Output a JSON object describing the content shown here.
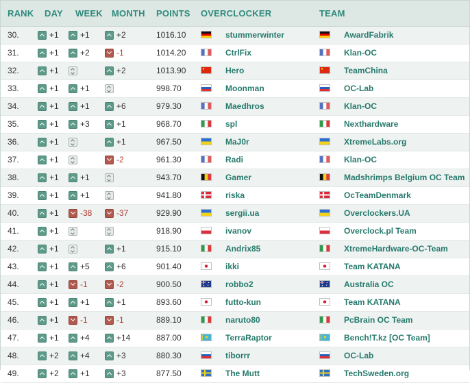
{
  "header": {
    "rank": "RANK",
    "day": "DAY",
    "week": "WEEK",
    "month": "MONTH",
    "points": "POINTS",
    "overclocker": "OVERCLOCKER",
    "team": "TEAM"
  },
  "colors": {
    "header_bg": "#dde8e5",
    "header_text": "#2f8a7c",
    "link": "#277a6d",
    "up": "#5e9a89",
    "down": "#b05a50",
    "negative_text": "#b03d30"
  },
  "flags": {
    "de": {
      "type": "h",
      "colors": [
        "#111111",
        "#dd0000",
        "#ffce00"
      ]
    },
    "fr": {
      "type": "v",
      "colors": [
        "#5472c2",
        "#ffffff",
        "#e05a5a"
      ]
    },
    "cn": {
      "type": "solid",
      "colors": [
        "#de2910"
      ]
    },
    "si": {
      "type": "h",
      "colors": [
        "#ffffff",
        "#2b5fbf",
        "#e03030"
      ]
    },
    "it": {
      "type": "v",
      "colors": [
        "#2f9a4a",
        "#ffffff",
        "#d83a3a"
      ]
    },
    "ua": {
      "type": "h",
      "colors": [
        "#2a6fd6",
        "#f3d31a"
      ]
    },
    "be": {
      "type": "v",
      "colors": [
        "#111111",
        "#f5d21c",
        "#e03a3a"
      ]
    },
    "dk": {
      "type": "cross",
      "colors": [
        "#d6293a",
        "#ffffff"
      ]
    },
    "pl": {
      "type": "h",
      "colors": [
        "#ffffff",
        "#dc2f3c"
      ]
    },
    "jp": {
      "type": "disc",
      "colors": [
        "#ffffff",
        "#d02035"
      ]
    },
    "au": {
      "type": "au",
      "colors": [
        "#1f3a8a",
        "#ffffff",
        "#cc2233"
      ]
    },
    "kz": {
      "type": "kz",
      "colors": [
        "#46b5d6",
        "#f3d31a"
      ]
    },
    "se": {
      "type": "cross",
      "colors": [
        "#2f6fbf",
        "#f3d31a"
      ]
    }
  },
  "rows": [
    {
      "rank": "30.",
      "day": {
        "dir": "up",
        "v": "+1"
      },
      "week": {
        "dir": "up",
        "v": "+1"
      },
      "month": {
        "dir": "up",
        "v": "+2"
      },
      "points": "1016.10",
      "oc": "stummerwinter",
      "oc_flag": "de",
      "team": "AwardFabrik",
      "team_flag": "de"
    },
    {
      "rank": "31.",
      "day": {
        "dir": "up",
        "v": "+1"
      },
      "week": {
        "dir": "up",
        "v": "+2"
      },
      "month": {
        "dir": "down",
        "v": "-1"
      },
      "points": "1014.20",
      "oc": "CtrlFix",
      "oc_flag": "fr",
      "team": "Klan-OC",
      "team_flag": "fr"
    },
    {
      "rank": "32.",
      "day": {
        "dir": "up",
        "v": "+1"
      },
      "week": {
        "dir": "same",
        "v": ""
      },
      "month": {
        "dir": "up",
        "v": "+2"
      },
      "points": "1013.90",
      "oc": "Hero",
      "oc_flag": "cn",
      "team": "TeamChina",
      "team_flag": "cn"
    },
    {
      "rank": "33.",
      "day": {
        "dir": "up",
        "v": "+1"
      },
      "week": {
        "dir": "up",
        "v": "+1"
      },
      "month": {
        "dir": "same",
        "v": ""
      },
      "points": "998.70",
      "oc": "Moonman",
      "oc_flag": "si",
      "team": "OC-Lab",
      "team_flag": "si"
    },
    {
      "rank": "34.",
      "day": {
        "dir": "up",
        "v": "+1"
      },
      "week": {
        "dir": "up",
        "v": "+1"
      },
      "month": {
        "dir": "up",
        "v": "+6"
      },
      "points": "979.30",
      "oc": "Maedhros",
      "oc_flag": "fr",
      "team": "Klan-OC",
      "team_flag": "fr"
    },
    {
      "rank": "35.",
      "day": {
        "dir": "up",
        "v": "+1"
      },
      "week": {
        "dir": "up",
        "v": "+3"
      },
      "month": {
        "dir": "up",
        "v": "+1"
      },
      "points": "968.70",
      "oc": "spl",
      "oc_flag": "it",
      "team": "Nexthardware",
      "team_flag": "it"
    },
    {
      "rank": "36.",
      "day": {
        "dir": "up",
        "v": "+1"
      },
      "week": {
        "dir": "same",
        "v": ""
      },
      "month": {
        "dir": "up",
        "v": "+1"
      },
      "points": "967.50",
      "oc": "MaJ0r",
      "oc_flag": "ua",
      "team": "XtremeLabs.org",
      "team_flag": "ua"
    },
    {
      "rank": "37.",
      "day": {
        "dir": "up",
        "v": "+1"
      },
      "week": {
        "dir": "same",
        "v": ""
      },
      "month": {
        "dir": "down",
        "v": "-2"
      },
      "points": "961.30",
      "oc": "Radi",
      "oc_flag": "fr",
      "team": "Klan-OC",
      "team_flag": "fr"
    },
    {
      "rank": "38.",
      "day": {
        "dir": "up",
        "v": "+1"
      },
      "week": {
        "dir": "up",
        "v": "+1"
      },
      "month": {
        "dir": "same",
        "v": ""
      },
      "points": "943.70",
      "oc": "Gamer",
      "oc_flag": "be",
      "team": "Madshrimps Belgium OC Team",
      "team_flag": "be"
    },
    {
      "rank": "39.",
      "day": {
        "dir": "up",
        "v": "+1"
      },
      "week": {
        "dir": "up",
        "v": "+1"
      },
      "month": {
        "dir": "same",
        "v": ""
      },
      "points": "941.80",
      "oc": "riska",
      "oc_flag": "dk",
      "team": "OcTeamDenmark",
      "team_flag": "dk"
    },
    {
      "rank": "40.",
      "day": {
        "dir": "up",
        "v": "+1"
      },
      "week": {
        "dir": "down",
        "v": "-38"
      },
      "month": {
        "dir": "down",
        "v": "-37"
      },
      "points": "929.90",
      "oc": "sergii.ua",
      "oc_flag": "ua",
      "team": "Overclockers.UA",
      "team_flag": "ua"
    },
    {
      "rank": "41.",
      "day": {
        "dir": "up",
        "v": "+1"
      },
      "week": {
        "dir": "same",
        "v": ""
      },
      "month": {
        "dir": "same",
        "v": ""
      },
      "points": "918.90",
      "oc": "ivanov",
      "oc_flag": "pl",
      "team": "Overclock.pl Team",
      "team_flag": "pl"
    },
    {
      "rank": "42.",
      "day": {
        "dir": "up",
        "v": "+1"
      },
      "week": {
        "dir": "same",
        "v": ""
      },
      "month": {
        "dir": "up",
        "v": "+1"
      },
      "points": "915.10",
      "oc": "Andrix85",
      "oc_flag": "it",
      "team": "XtremeHardware-OC-Team",
      "team_flag": "it"
    },
    {
      "rank": "43.",
      "day": {
        "dir": "up",
        "v": "+1"
      },
      "week": {
        "dir": "up",
        "v": "+5"
      },
      "month": {
        "dir": "up",
        "v": "+6"
      },
      "points": "901.40",
      "oc": "ikki",
      "oc_flag": "jp",
      "team": "Team KATANA",
      "team_flag": "jp"
    },
    {
      "rank": "44.",
      "day": {
        "dir": "up",
        "v": "+1"
      },
      "week": {
        "dir": "down",
        "v": "-1"
      },
      "month": {
        "dir": "down",
        "v": "-2"
      },
      "points": "900.50",
      "oc": "robbo2",
      "oc_flag": "au",
      "team": "Australia OC",
      "team_flag": "au"
    },
    {
      "rank": "45.",
      "day": {
        "dir": "up",
        "v": "+1"
      },
      "week": {
        "dir": "up",
        "v": "+1"
      },
      "month": {
        "dir": "up",
        "v": "+1"
      },
      "points": "893.60",
      "oc": "futto-kun",
      "oc_flag": "jp",
      "team": "Team KATANA",
      "team_flag": "jp"
    },
    {
      "rank": "46.",
      "day": {
        "dir": "up",
        "v": "+1"
      },
      "week": {
        "dir": "down",
        "v": "-1"
      },
      "month": {
        "dir": "down",
        "v": "-1"
      },
      "points": "889.10",
      "oc": "naruto80",
      "oc_flag": "it",
      "team": "PcBrain OC Team",
      "team_flag": "it"
    },
    {
      "rank": "47.",
      "day": {
        "dir": "up",
        "v": "+1"
      },
      "week": {
        "dir": "up",
        "v": "+4"
      },
      "month": {
        "dir": "up",
        "v": "+14"
      },
      "points": "887.00",
      "oc": "TerraRaptor",
      "oc_flag": "kz",
      "team": "Bench!T.kz [OC Team]",
      "team_flag": "kz"
    },
    {
      "rank": "48.",
      "day": {
        "dir": "up",
        "v": "+2"
      },
      "week": {
        "dir": "up",
        "v": "+4"
      },
      "month": {
        "dir": "up",
        "v": "+3"
      },
      "points": "880.30",
      "oc": "tiborrr",
      "oc_flag": "si",
      "team": "OC-Lab",
      "team_flag": "si"
    },
    {
      "rank": "49.",
      "day": {
        "dir": "up",
        "v": "+2"
      },
      "week": {
        "dir": "up",
        "v": "+1"
      },
      "month": {
        "dir": "up",
        "v": "+3"
      },
      "points": "877.50",
      "oc": "The Mutt",
      "oc_flag": "se",
      "team": "TechSweden.org",
      "team_flag": "se"
    }
  ]
}
